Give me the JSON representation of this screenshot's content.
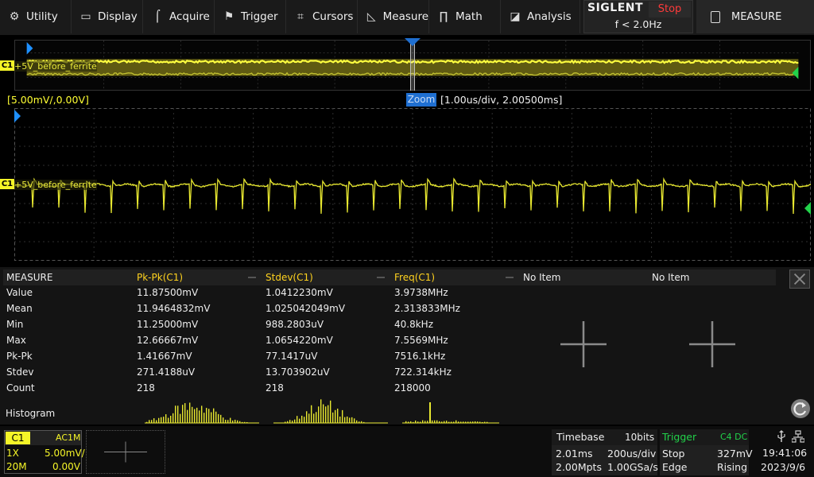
{
  "menu": {
    "items": [
      {
        "label": "Utility",
        "icon": "utility-icon"
      },
      {
        "label": "Display",
        "icon": "display-icon"
      },
      {
        "label": "Acquire",
        "icon": "acquire-icon"
      },
      {
        "label": "Trigger",
        "icon": "trigger-flag-icon"
      },
      {
        "label": "Cursors",
        "icon": "cursors-icon"
      },
      {
        "label": "Measure",
        "icon": "measure-icon"
      },
      {
        "label": "Math",
        "icon": "math-icon"
      },
      {
        "label": "Analysis",
        "icon": "analysis-icon"
      }
    ]
  },
  "brand": {
    "logo": "SIGLENT",
    "run_state": "Stop",
    "trigger_freq": "f < 2.0Hz"
  },
  "measure_tab": {
    "label": "MEASURE",
    "icon": "document-icon"
  },
  "overview": {
    "marker_label": "T"
  },
  "channel": {
    "tag": "C1",
    "label": "+5V_before_ferrite"
  },
  "zoom": {
    "main_scale": "[5.00mV/,0.00V]",
    "badge": "Zoom",
    "info": "[1.00us/div, 2.00500ms]"
  },
  "measure_table": {
    "header": [
      "MEASURE",
      "Pk-Pk(C1)",
      "Stdev(C1)",
      "Freq(C1)",
      "No Item",
      "No Item"
    ],
    "rows": [
      [
        "Value",
        "11.87500mV",
        "1.0412230mV",
        "3.9738MHz"
      ],
      [
        "Mean",
        "11.9464832mV",
        "1.025042049mV",
        "2.313833MHz"
      ],
      [
        "Min",
        "11.25000mV",
        "988.2803uV",
        "40.8kHz"
      ],
      [
        "Max",
        "12.66667mV",
        "1.0654220mV",
        "7.5569MHz"
      ],
      [
        "Pk-Pk",
        "1.41667mV",
        "77.1417uV",
        "7516.1kHz"
      ],
      [
        "Stdev",
        "271.4188uV",
        "13.703902uV",
        "722.314kHz"
      ],
      [
        "Count",
        "218",
        "218",
        "218000"
      ]
    ],
    "histogram_label": "Histogram"
  },
  "channel_box": {
    "name": "C1",
    "coupling": "AC1M",
    "probe": "1X",
    "scale": "5.00mV/",
    "bw_limit": "20M",
    "offset": "0.00V"
  },
  "timebase": {
    "title": "Timebase",
    "bits": "10bits",
    "delay": "2.01ms",
    "scale": "200us/div",
    "memory": "2.00Mpts",
    "sample_rate": "1.00GSa/s"
  },
  "trigger": {
    "title": "Trigger",
    "source": "C4 DC",
    "mode": "Stop",
    "level": "327mV",
    "type": "Edge",
    "slope": "Rising"
  },
  "clock": {
    "time": "19:41:06",
    "date": "2023/9/6"
  },
  "colors": {
    "ch1": "#f5f528",
    "trigger": "#22d24a",
    "stop": "#ff3a3a",
    "zoom": "#1f6fd1"
  }
}
